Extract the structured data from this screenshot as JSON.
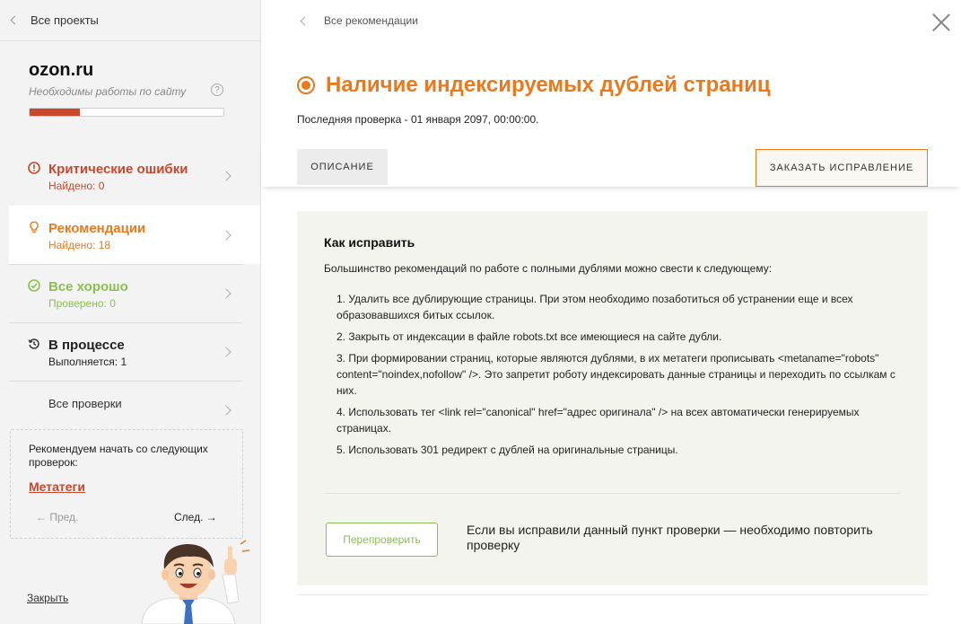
{
  "colors": {
    "accent_orange": "#e8791d",
    "critical_red": "#c9472b",
    "ok_green": "#8ac050",
    "sidebar_bg": "#f3f3f3",
    "card_bg": "#f4f4ee"
  },
  "sidebar": {
    "back_label": "Все проекты",
    "site_name": "ozon.ru",
    "subtitle": "Необходимы работы по сайту",
    "help_symbol": "?",
    "progress_fraction": 0.26,
    "items": [
      {
        "icon": "alert-circle-icon",
        "title": "Критические ошибки",
        "count": "Найдено: 0"
      },
      {
        "icon": "lightbulb-icon",
        "title": "Рекомендации",
        "count": "Найдено: 18"
      },
      {
        "icon": "check-circle-icon",
        "title": "Все хорошо",
        "count": "Проверено: 0"
      },
      {
        "icon": "history-icon",
        "title": "В процессе",
        "count": "Выполняется: 1"
      }
    ],
    "all_checks_label": "Все проверки",
    "recommend": {
      "text": "Рекомендуем начать со следующих проверок:",
      "link": "Метатеги",
      "prev": "← Пред.",
      "next": "След. →"
    },
    "close_label": "Закрыть"
  },
  "main": {
    "back_label": "Все рекомендации",
    "title": "Наличие индексируемых дублей страниц",
    "last_check": "Последняя проверка - 01 января 2097, 00:00:00.",
    "tab_description": "ОПИСАНИЕ",
    "order_button": "ЗАКАЗАТЬ ИСПРАВЛЕНИЕ",
    "fix": {
      "title": "Как исправить",
      "intro": "Большинство рекомендаций по работе с полными дублями можно свести к следующему:",
      "steps": [
        "1. Удалить все дублирующие страницы. При этом необходимо позаботиться об устранении еще и всех образовавшихся битых ссылок.",
        "2. Закрыть от индексации в файле robots.txt все имеющиеся на сайте дубли.",
        "3. При формировании страниц, которые являются дублями, в их метатеги прописывать <metaname=\"robots\" content=\"noindex,nofollow\" />. Это запретит роботу индексировать данные страницы и переходить по ссылкам с них.",
        "4. Использовать тег <link rel=\"canonical\" href=\"адрес оригинала\" /> на всех автоматически генерируемых страницах.",
        "5. Использовать 301 редирект с дублей на оригинальные страницы."
      ],
      "recheck_button": "Перепроверить",
      "recheck_note": "Если вы исправили данный пункт проверки — необходимо повторить проверку"
    }
  }
}
